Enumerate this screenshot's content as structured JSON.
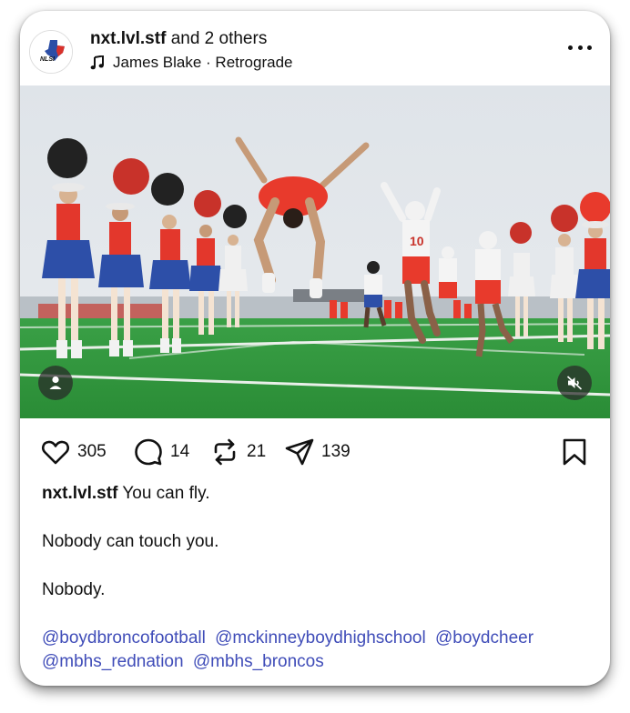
{
  "post": {
    "author": "nxt.lvl.stf",
    "collab_suffix": "and 2 others",
    "audio": "James Blake · Retrograde",
    "avatar_text": "NLSI",
    "more_icon": "more-horizontal-icon"
  },
  "actions": {
    "likes": "305",
    "comments": "14",
    "reposts": "21",
    "shares": "139"
  },
  "caption": {
    "username": "nxt.lvl.stf",
    "line1": "You can fly.",
    "line2": "Nobody can touch you.",
    "line3": "Nobody.",
    "hashtags": [
      "@boydbroncofootball",
      "@mckinneyboydhighschool",
      "@boydcheer",
      "@mbhs_rednation",
      "@mbhs_broncos"
    ]
  },
  "colors": {
    "link": "#3f4cb8",
    "turf": "#2f9a3c",
    "uniform_red": "#e83a2c",
    "cheer_blue": "#2d4fa8"
  }
}
